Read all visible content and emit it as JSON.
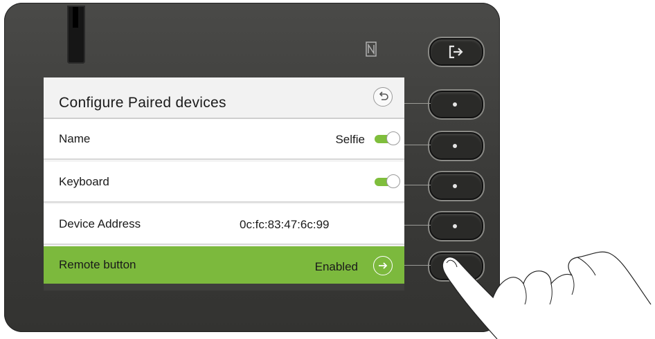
{
  "header": {
    "title": "Configure Paired devices"
  },
  "rows": [
    {
      "label": "Name",
      "value": "Selfie",
      "toggle": "on"
    },
    {
      "label": "Keyboard",
      "value": "",
      "toggle": "on"
    },
    {
      "label": "Device Address",
      "value": "0c:fc:83:47:6c:99"
    },
    {
      "label": "Remote button",
      "value": "Enabled",
      "selected": true
    }
  ],
  "icons": {
    "back": "back-arrow-icon",
    "forward": "forward-arrow-icon",
    "logout": "logout-icon",
    "nfc": "nfc-icon"
  },
  "colors": {
    "selection": "#7cb93d",
    "toggle_on": "#7fbe3c",
    "bezel": "#3c3c3a"
  }
}
